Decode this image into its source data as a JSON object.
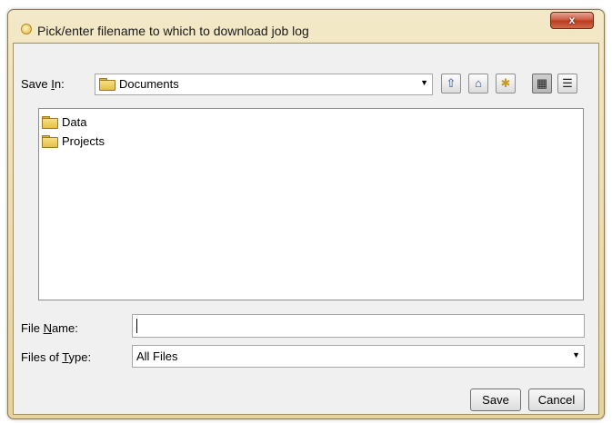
{
  "window": {
    "title": "Pick/enter filename to which to download job log",
    "close_label": "x"
  },
  "save_in": {
    "label_before": "Save ",
    "label_accel": "I",
    "label_after": "n:",
    "value": "Documents"
  },
  "toolbar": {
    "up_icon": "up-folder-icon",
    "home_icon": "home-icon",
    "new_folder_icon": "new-folder-icon",
    "list_view_icon": "list-view-icon",
    "details_view_icon": "details-view-icon"
  },
  "files": [
    {
      "name": "Data"
    },
    {
      "name": "Projects"
    }
  ],
  "file_name": {
    "label_before": "File ",
    "label_accel": "N",
    "label_after": "ame:",
    "value": ""
  },
  "file_type": {
    "label_before": "Files of ",
    "label_accel": "T",
    "label_after": "ype:",
    "value": "All Files"
  },
  "buttons": {
    "save": "Save",
    "cancel": "Cancel"
  },
  "colors": {
    "title_bar": "#e9d9a8",
    "close_button": "#c9553a",
    "folder": "#e7bf46"
  }
}
